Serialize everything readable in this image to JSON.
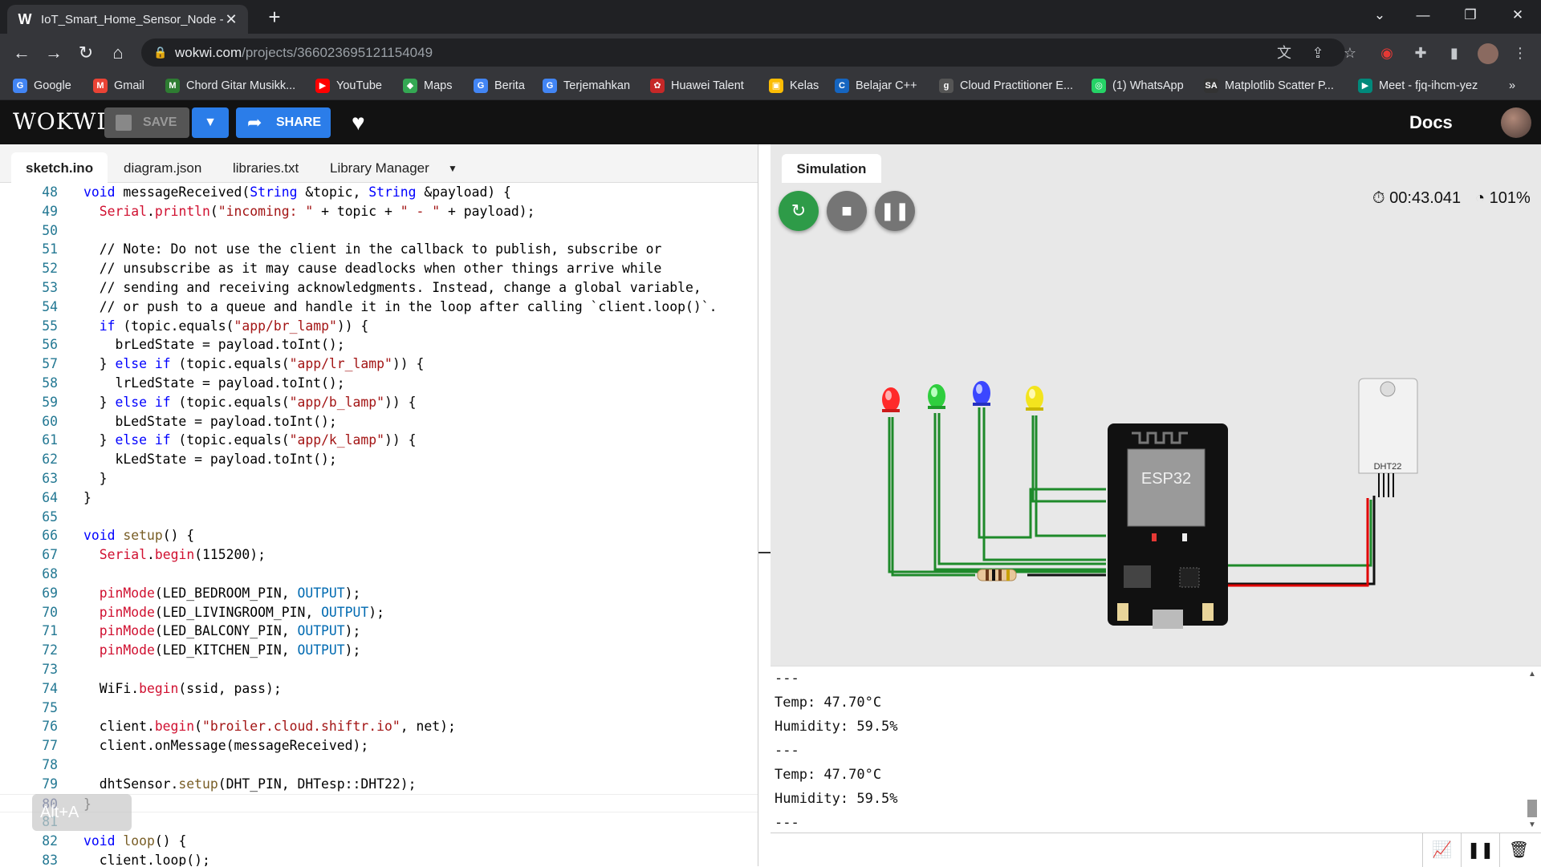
{
  "browser": {
    "tab_title": "IoT_Smart_Home_Sensor_Node -",
    "url_host": "wokwi.com",
    "url_path": "/projects/366023695121154049",
    "bookmarks": [
      {
        "label": "Google",
        "color": "#4285f4",
        "glyph": "G"
      },
      {
        "label": "Gmail",
        "color": "#ea4335",
        "glyph": "M"
      },
      {
        "label": "Chord Gitar Musikk...",
        "color": "#2e7d32",
        "glyph": "M"
      },
      {
        "label": "YouTube",
        "color": "#ff0000",
        "glyph": "▶"
      },
      {
        "label": "Maps",
        "color": "#34a853",
        "glyph": "◆"
      },
      {
        "label": "Berita",
        "color": "#4285f4",
        "glyph": "G"
      },
      {
        "label": "Terjemahkan",
        "color": "#4285f4",
        "glyph": "G"
      },
      {
        "label": "Huawei Talent",
        "color": "#c62828",
        "glyph": "✿"
      },
      {
        "label": "Kelas",
        "color": "#fbbc04",
        "glyph": "▣"
      },
      {
        "label": "Belajar C++",
        "color": "#1565c0",
        "glyph": "C"
      },
      {
        "label": "Cloud Practitioner E...",
        "color": "#555555",
        "glyph": "g"
      },
      {
        "label": "(1) WhatsApp",
        "color": "#25d366",
        "glyph": "◎"
      },
      {
        "label": "Matplotlib Scatter P...",
        "color": "#333333",
        "glyph": "SA"
      },
      {
        "label": "Meet - fjq-ihcm-yez",
        "color": "#00897b",
        "glyph": "▶"
      }
    ],
    "more_bookmarks": "»"
  },
  "wokwi": {
    "logo": "WOKWI",
    "save_label": "SAVE",
    "share_label": "SHARE",
    "docs_label": "Docs"
  },
  "editor": {
    "tabs": [
      "sketch.ino",
      "diagram.json",
      "libraries.txt",
      "Library Manager"
    ],
    "active_tab": "sketch.ino",
    "line_numbers": [
      "48",
      "49",
      "50",
      "51",
      "52",
      "53",
      "54",
      "55",
      "56",
      "57",
      "58",
      "59",
      "60",
      "61",
      "62",
      "63",
      "64",
      "65",
      "66",
      "67",
      "68",
      "69",
      "70",
      "71",
      "72",
      "73",
      "74",
      "75",
      "76",
      "77",
      "78",
      "79",
      "80",
      "81",
      "82",
      "83"
    ],
    "overlay_hint": "Alt+A"
  },
  "simulation": {
    "tab_label": "Simulation",
    "timer": "00:43.041",
    "speed": "101%",
    "chip_label": "ESP32",
    "sensor_label": "DHT22",
    "led_colors": [
      "#ff3030",
      "#30d040",
      "#3040ff",
      "#f0e020"
    ]
  },
  "serial": {
    "lines": [
      "---",
      "Temp: 47.70°C",
      "Humidity: 59.5%",
      "---",
      "Temp: 47.70°C",
      "Humidity: 59.5%",
      "---"
    ]
  }
}
